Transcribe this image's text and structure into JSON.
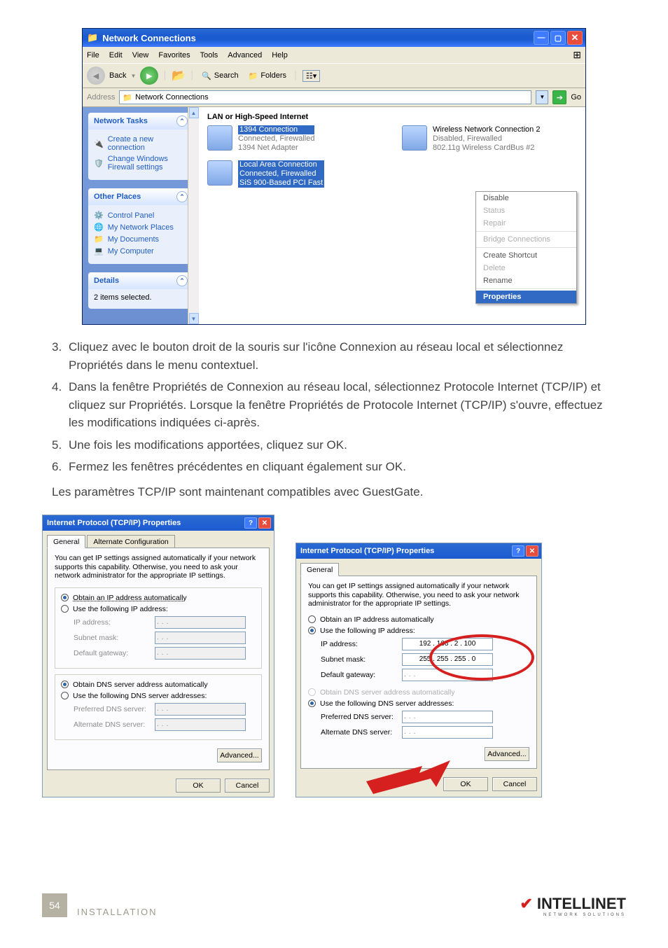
{
  "nc": {
    "title": "Network Connections",
    "menu": [
      "File",
      "Edit",
      "View",
      "Favorites",
      "Tools",
      "Advanced",
      "Help"
    ],
    "toolbar": {
      "back": "Back",
      "search": "Search",
      "folders": "Folders"
    },
    "addr": {
      "label": "Address",
      "value": "Network Connections",
      "go": "Go"
    },
    "sidebar": {
      "network_tasks": {
        "title": "Network Tasks",
        "items": [
          "Create a new connection",
          "Change Windows Firewall settings"
        ]
      },
      "other_places": {
        "title": "Other Places",
        "items": [
          "Control Panel",
          "My Network Places",
          "My Documents",
          "My Computer"
        ]
      },
      "details": {
        "title": "Details",
        "text": "2 items selected."
      }
    },
    "content": {
      "category": "LAN or High-Speed Internet",
      "c1": {
        "name": "1394 Connection",
        "line2": "Connected, Firewalled",
        "line3": "1394 Net Adapter"
      },
      "c2": {
        "name": "Wireless Network Connection 2",
        "line2": "Disabled, Firewalled",
        "line3": "802.11g Wireless CardBus #2"
      },
      "c3": {
        "name": "Local Area Connection",
        "line2": "Connected, Firewalled",
        "line3": "SiS 900-Based PCI Fast"
      }
    },
    "ctx": [
      "Disable",
      "Status",
      "Repair",
      "Bridge Connections",
      "Create Shortcut",
      "Delete",
      "Rename",
      "Properties"
    ]
  },
  "doc": {
    "s3n": "3.",
    "s3": "Cliquez avec le bouton droit de la souris sur l'icône Connexion au réseau local et sélectionnez Propriétés dans le menu contextuel.",
    "s4n": "4.",
    "s4": "Dans la fenêtre Propriétés de Connexion au réseau local, sélectionnez Protocole Internet (TCP/IP) et cliquez sur Propriétés. Lorsque la fenêtre Propriétés de Protocole Internet (TCP/IP) s'ouvre, effectuez les modifications indiquées ci-après.",
    "s5n": "5.",
    "s5": "Une fois les modifications apportées, cliquez sur OK.",
    "s6n": "6.",
    "s6": "Fermez les fenêtres précédentes en cliquant également sur OK.",
    "p": "Les paramètres TCP/IP sont maintenant compatibles avec GuestGate."
  },
  "dlg": {
    "title": "Internet Protocol (TCP/IP) Properties",
    "tab1": "General",
    "tab2": "Alternate Configuration",
    "intro": "You can get IP settings assigned automatically if your network supports this capability. Otherwise, you need to ask your network administrator for the appropriate IP settings.",
    "r1": "Obtain an IP address automatically",
    "r2": "Use the following IP address:",
    "f_ip": "IP address:",
    "f_mask": "Subnet mask:",
    "f_gw": "Default gateway:",
    "r3": "Obtain DNS server address automatically",
    "r4": "Use the following DNS server addresses:",
    "f_dns1": "Preferred DNS server:",
    "f_dns2": "Alternate DNS server:",
    "adv": "Advanced...",
    "ok": "OK",
    "cancel": "Cancel",
    "ip_value": "192 . 168 .   2 . 100",
    "mask_value": "255 . 255 . 255 .   0"
  },
  "footer": {
    "page": "54",
    "install": "INSTALLATION",
    "brand": "INTELLINET",
    "tag": "NETWORK SOLUTIONS"
  }
}
